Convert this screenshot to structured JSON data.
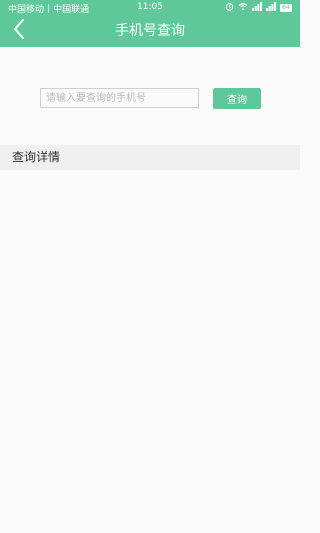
{
  "status_bar": {
    "carrier1": "中国移动",
    "carrier2": "中国联通",
    "time": "11:05",
    "battery": "64"
  },
  "header": {
    "title": "手机号查询",
    "back_icon": "chevron-left-icon"
  },
  "search": {
    "placeholder": "请输入要查询的手机号",
    "value": "",
    "button_label": "查询"
  },
  "detail": {
    "title": "查询详情"
  },
  "colors": {
    "accent": "#5ec89a",
    "background": "#fafafa",
    "section_header": "#efefef"
  }
}
